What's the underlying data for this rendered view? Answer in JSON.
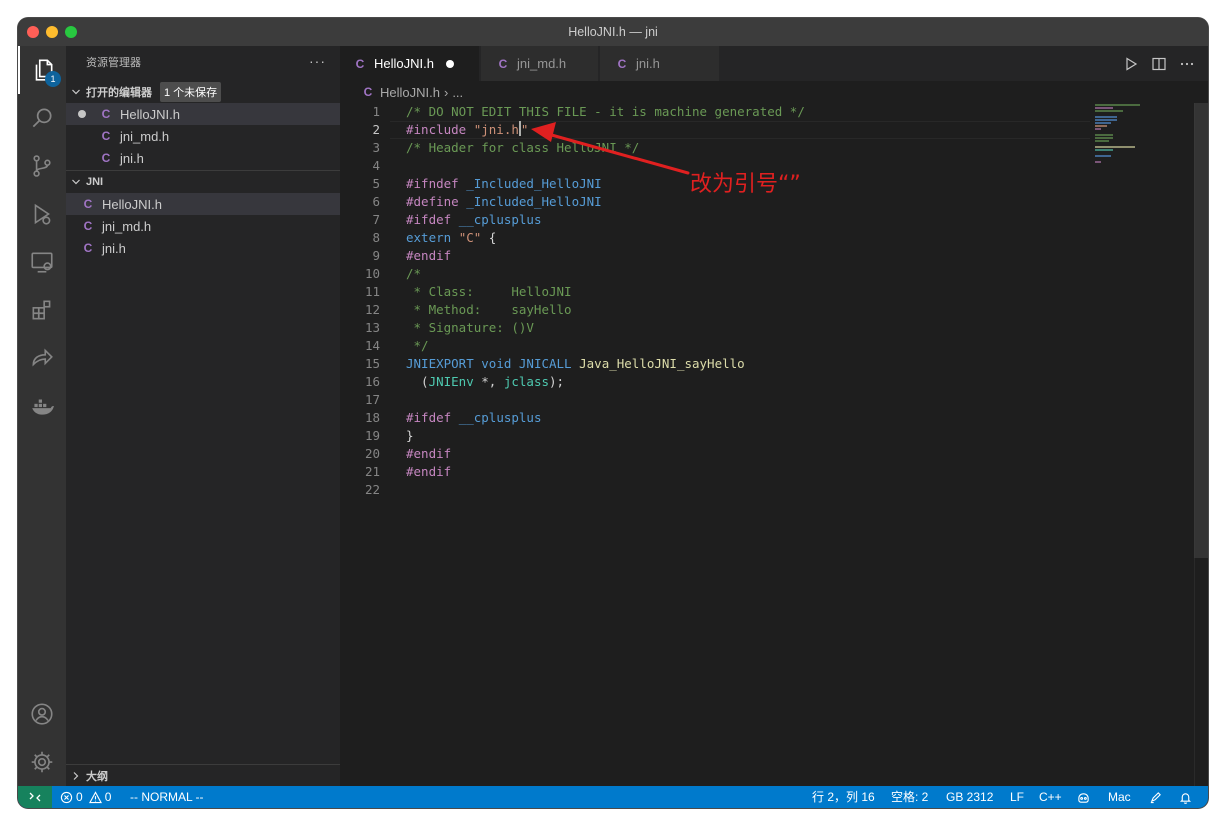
{
  "window": {
    "title": "HelloJNI.h — jni"
  },
  "activity_bar": {
    "explorer_badge": "1"
  },
  "sidebar": {
    "title": "资源管理器",
    "more": "···",
    "open_editors": {
      "label": "打开的编辑器",
      "unsaved_badge": "1 个未保存",
      "files": [
        "HelloJNI.h",
        "jni_md.h",
        "jni.h"
      ]
    },
    "folder": {
      "label": "JNI",
      "files": [
        "HelloJNI.h",
        "jni_md.h",
        "jni.h"
      ]
    },
    "outline": {
      "label": "大纲"
    }
  },
  "file_icon": "C",
  "tabs": [
    {
      "label": "HelloJNI.h",
      "dirty": true,
      "active": true
    },
    {
      "label": "jni_md.h",
      "dirty": false,
      "active": false
    },
    {
      "label": "jni.h",
      "dirty": false,
      "active": false
    }
  ],
  "breadcrumb": {
    "file": "HelloJNI.h",
    "rest": "..."
  },
  "editor": {
    "line_numbers": [
      "1",
      "2",
      "3",
      "4",
      "5",
      "6",
      "7",
      "8",
      "9",
      "10",
      "11",
      "12",
      "13",
      "14",
      "15",
      "16",
      "17",
      "18",
      "19",
      "20",
      "21",
      "22"
    ],
    "line1": "/* DO NOT EDIT THIS FILE - it is machine generated */",
    "line2_pre": "#include ",
    "line2_str": "\"jni.h",
    "line2_str_end": "\"",
    "line3": "/* Header for class HelloJNI */",
    "line5_pre": "#ifndef",
    "line5_var": "_Included_HelloJNI",
    "line6_pre": "#define",
    "line6_var": "_Included_HelloJNI",
    "line7_pre": "#ifdef",
    "line7_var": "__cplusplus",
    "line8_kw": "extern",
    "line8_str": "\"C\"",
    "line8_brace": "{",
    "line9": "#endif",
    "line10": "/*",
    "line11": " * Class:     HelloJNI",
    "line12": " * Method:    sayHello",
    "line13": " * Signature: ()V",
    "line14": " */",
    "line15_kw1": "JNIEXPORT",
    "line15_kw2": "void",
    "line15_kw3": "JNICALL",
    "line15_fn": "Java_HelloJNI_sayHello",
    "line16_open": "  (",
    "line16_type": "JNIEnv",
    "line16_mid": " *, ",
    "line16_var": "jclass",
    "line16_close": ");",
    "line18_pre": "#ifdef",
    "line18_var": "__cplusplus",
    "line19": "}",
    "line20": "#endif",
    "line21": "#endif"
  },
  "annotation": {
    "text": "改为引号“”",
    "color": "#e02020"
  },
  "statusbar": {
    "errors": "0",
    "warnings": "0",
    "mode": "-- NORMAL --",
    "position": "行 2，列 16",
    "spaces": "空格: 2",
    "encoding": "GB 2312",
    "eol": "LF",
    "language": "C++",
    "platform": "Mac"
  },
  "colors": {
    "statusbar": "#007acc",
    "remote": "#16825d",
    "c_file_icon": "#a074c4"
  }
}
